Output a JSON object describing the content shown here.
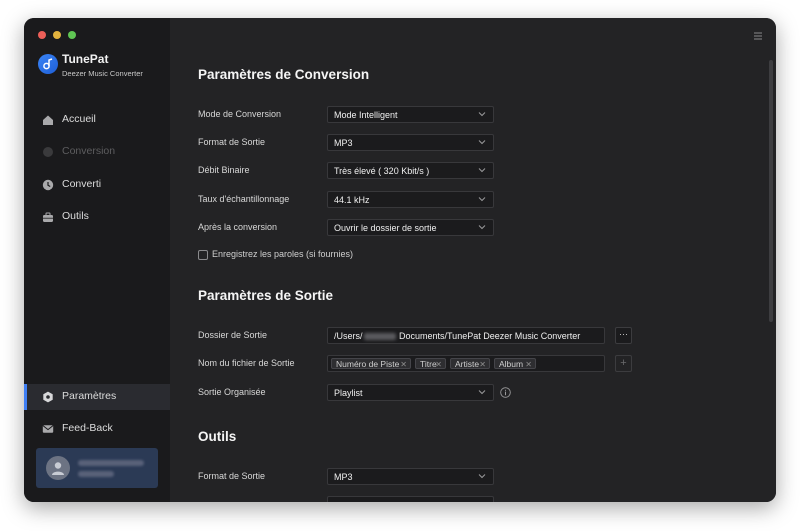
{
  "app": {
    "name": "TunePat",
    "subtitle": "Deezer Music Converter"
  },
  "sidebar": {
    "items": [
      {
        "label": "Accueil",
        "icon": "home-icon"
      },
      {
        "label": "Conversion",
        "icon": "conversion-icon",
        "disabled": true
      },
      {
        "label": "Converti",
        "icon": "clock-icon"
      },
      {
        "label": "Outils",
        "icon": "toolbox-icon"
      }
    ],
    "bottom_items": [
      {
        "label": "Paramètres",
        "icon": "gear-icon",
        "active": true
      },
      {
        "label": "Feed-Back",
        "icon": "mail-icon"
      }
    ]
  },
  "conversion": {
    "title": "Paramètres de Conversion",
    "rows": [
      {
        "label": "Mode de Conversion",
        "value": "Mode Intelligent"
      },
      {
        "label": "Format de Sortie",
        "value": "MP3"
      },
      {
        "label": "Débit Binaire",
        "value": "Très élevé ( 320 Kbit/s )"
      },
      {
        "label": "Taux d'échantillonnage",
        "value": "44.1 kHz"
      },
      {
        "label": "Après la conversion",
        "value": "Ouvrir le dossier de sortie"
      }
    ],
    "lyrics_checkbox": {
      "label": "Enregistrez les paroles (si fournies)",
      "checked": false
    }
  },
  "output": {
    "title": "Paramètres de Sortie",
    "folder_label": "Dossier de Sortie",
    "folder_prefix": "/Users/",
    "folder_suffix": "Documents/TunePat Deezer Music Converter",
    "browse_label": "···",
    "filename_label": "Nom du fichier de Sortie",
    "filename_tags": [
      "Numéro de Piste",
      "Titre",
      "Artiste",
      "Album"
    ],
    "add_label": "+",
    "organized_label": "Sortie Organisée",
    "organized_value": "Playlist"
  },
  "tools": {
    "title": "Outils",
    "rows": [
      {
        "label": "Format de Sortie",
        "value": "MP3"
      }
    ]
  },
  "colors": {
    "accent": "#3f7ff5",
    "window_bg": "#232325",
    "sidebar_bg": "#1a1a1c",
    "user_card_bg": "#2b3a55"
  }
}
